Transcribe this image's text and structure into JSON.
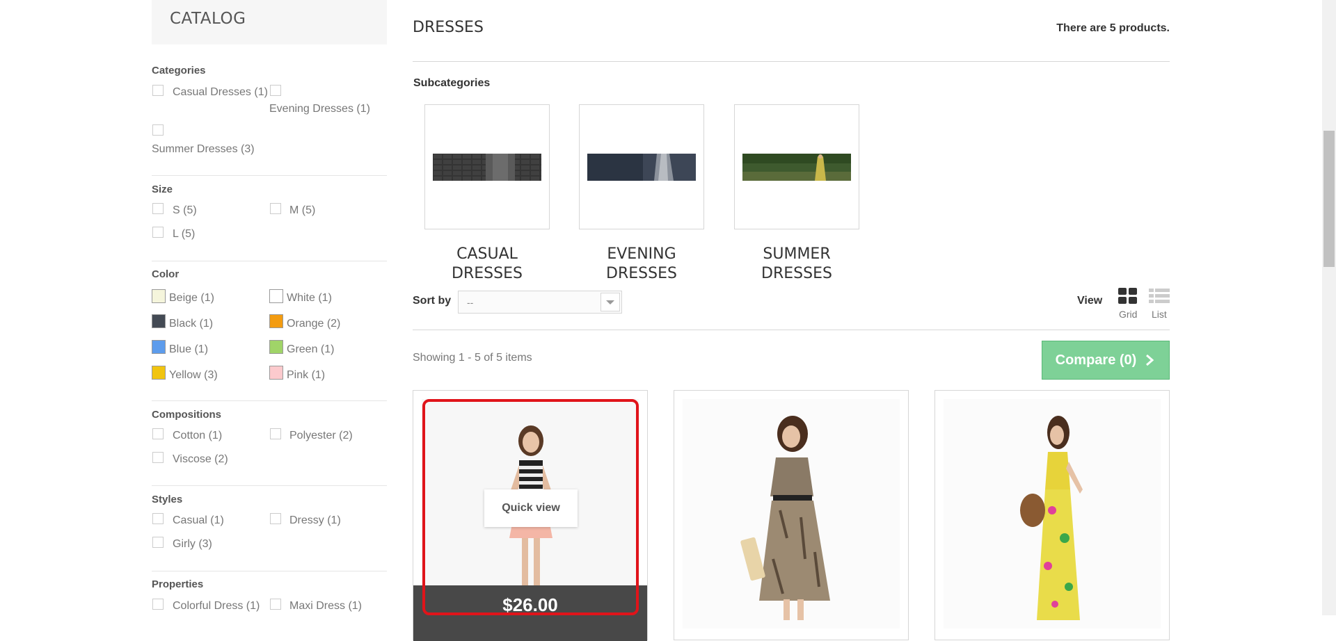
{
  "sidebar": {
    "title": "CATALOG",
    "categories": {
      "title": "Categories",
      "items": [
        "Casual Dresses (1)",
        "Evening Dresses (1)",
        "Summer Dresses (3)"
      ]
    },
    "size": {
      "title": "Size",
      "items": [
        "S (5)",
        "M (5)",
        "L (5)"
      ]
    },
    "color": {
      "title": "Color",
      "items": [
        {
          "label": "Beige (1)",
          "color": "#f5f5dc"
        },
        {
          "label": "White (1)",
          "color": "#ffffff"
        },
        {
          "label": "Black (1)",
          "color": "#434a54"
        },
        {
          "label": "Orange (2)",
          "color": "#f39c11"
        },
        {
          "label": "Blue (1)",
          "color": "#5d9cec"
        },
        {
          "label": "Green (1)",
          "color": "#a0d468"
        },
        {
          "label": "Yellow (3)",
          "color": "#f1c40f"
        },
        {
          "label": "Pink (1)",
          "color": "#fccacd"
        }
      ]
    },
    "compositions": {
      "title": "Compositions",
      "items": [
        "Cotton (1)",
        "Polyester (2)",
        "Viscose (2)"
      ]
    },
    "styles": {
      "title": "Styles",
      "items": [
        "Casual (1)",
        "Dressy (1)",
        "Girly (3)"
      ]
    },
    "properties": {
      "title": "Properties",
      "items": [
        "Colorful Dress (1)",
        "Maxi Dress (1)"
      ]
    }
  },
  "main": {
    "title": "DRESSES",
    "product_count": "There are 5 products.",
    "subcategories_heading": "Subcategories",
    "subcategories": [
      {
        "line1": "CASUAL",
        "line2": "DRESSES"
      },
      {
        "line1": "EVENING",
        "line2": "DRESSES"
      },
      {
        "line1": "SUMMER",
        "line2": "DRESSES"
      }
    ],
    "sort_label": "Sort by",
    "sort_value": "--",
    "view_label": "View",
    "view_grid": "Grid",
    "view_list": "List",
    "showing": "Showing 1 - 5 of 5 items",
    "compare_label": "Compare (0)",
    "products": [
      {
        "price": "$26.00",
        "quick_view": "Quick view"
      }
    ]
  },
  "colors": {
    "accent_green": "#7ed197",
    "highlight_red": "#e0141a",
    "price_bar": "#484848"
  }
}
